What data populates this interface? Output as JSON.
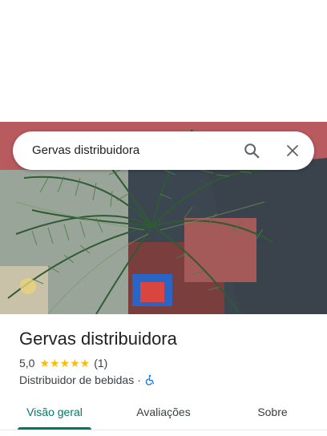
{
  "search": {
    "query": "Gervas distribuidora",
    "search_icon": "search-icon",
    "close_icon": "close-icon"
  },
  "photo": {
    "subject": "palm-plant-photo"
  },
  "place": {
    "name": "Gervas distribuidora",
    "rating_value": "5,0",
    "stars": "★★★★★",
    "rating_stars": 5,
    "review_count": "(1)",
    "category": "Distribuidor de bebidas",
    "separator": "·",
    "accessibility_icon": "wheelchair-icon"
  },
  "tabs": [
    {
      "label": "Visão geral",
      "active": true
    },
    {
      "label": "Avaliações",
      "active": false
    },
    {
      "label": "Sobre",
      "active": false
    }
  ],
  "colors": {
    "accent": "#00796b",
    "star": "#fbbc04",
    "accessibility": "#1a73e8"
  }
}
